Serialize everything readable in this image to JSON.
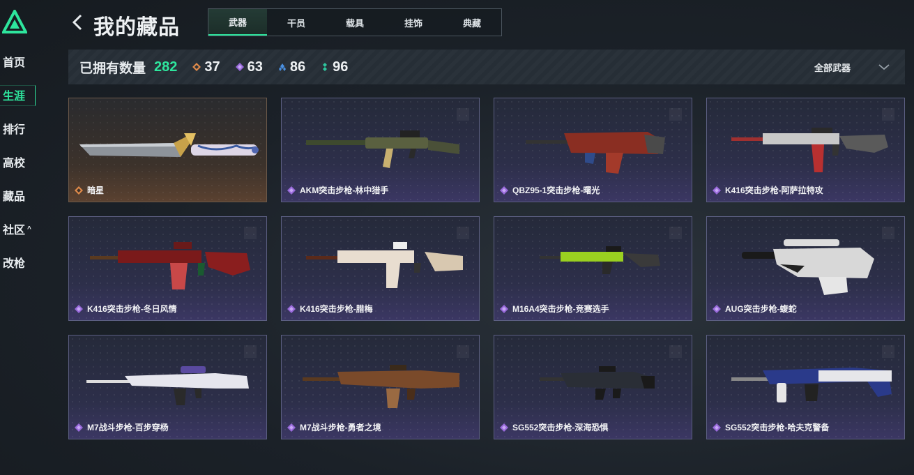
{
  "sidebar": {
    "items": [
      {
        "label": "首页"
      },
      {
        "label": "生涯"
      },
      {
        "label": "排行"
      },
      {
        "label": "高校"
      },
      {
        "label": "藏品"
      },
      {
        "label": "社区"
      },
      {
        "label": "改枪"
      }
    ],
    "active_index": 1
  },
  "header": {
    "title": "我的藏品",
    "tabs": [
      {
        "label": "武器"
      },
      {
        "label": "干员"
      },
      {
        "label": "载具"
      },
      {
        "label": "挂饰"
      },
      {
        "label": "典藏"
      }
    ],
    "active_tab": 0
  },
  "stats": {
    "owned_label": "已拥有数量",
    "owned_value": "282",
    "rarities": [
      {
        "icon": "orange-diamond-icon",
        "color": "#e08a4a",
        "value": "37"
      },
      {
        "icon": "purple-diamond-icon",
        "color": "#9a6bdc",
        "value": "63"
      },
      {
        "icon": "blue-diamond-icon",
        "color": "#4a8fe0",
        "value": "86"
      },
      {
        "icon": "green-diamond-icon",
        "color": "#2ec59d",
        "value": "96"
      }
    ],
    "filter_label": "全部武器"
  },
  "items": [
    {
      "name": "暗星",
      "rarity": "orange"
    },
    {
      "name": "AKM突击步枪-林中猎手",
      "rarity": "purple"
    },
    {
      "name": "QBZ95-1突击步枪-曙光",
      "rarity": "purple"
    },
    {
      "name": "K416突击步枪-阿萨拉特攻",
      "rarity": "purple"
    },
    {
      "name": "K416突击步枪-冬日风情",
      "rarity": "purple"
    },
    {
      "name": "K416突击步枪-腊梅",
      "rarity": "purple"
    },
    {
      "name": "M16A4突击步枪-竞赛选手",
      "rarity": "purple"
    },
    {
      "name": "AUG突击步枪-蝮蛇",
      "rarity": "purple"
    },
    {
      "name": "M7战斗步枪-百步穿杨",
      "rarity": "purple"
    },
    {
      "name": "M7战斗步枪-勇者之境",
      "rarity": "purple"
    },
    {
      "name": "SG552突击步枪-深海恐惧",
      "rarity": "purple"
    },
    {
      "name": "SG552突击步枪-哈夫克警备",
      "rarity": "purple"
    }
  ],
  "colors": {
    "accent": "#2ee59d",
    "orange": "#e08a4a",
    "purple": "#9a6bdc"
  }
}
